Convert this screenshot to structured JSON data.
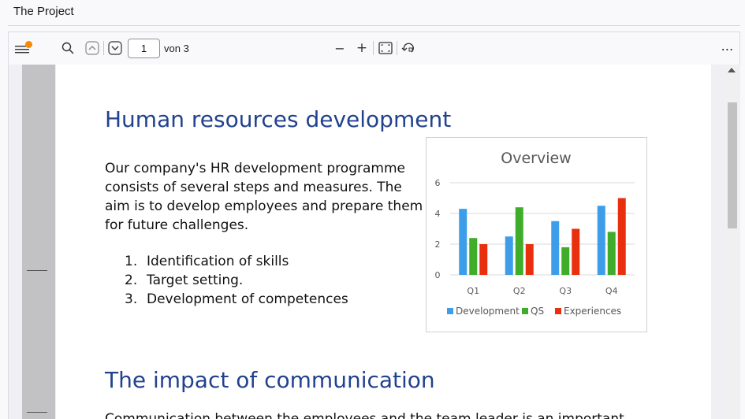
{
  "window": {
    "title": "The Project"
  },
  "toolbar": {
    "page_number": "1",
    "page_count_label": "von 3",
    "zoom_out_label": "−",
    "zoom_in_label": "+",
    "more_label": "⋯",
    "accent_color": "#f28a0c"
  },
  "document": {
    "heading1": "Human resources development",
    "intro": "Our company's HR development programme consists of several steps and measures. The aim is to develop employees and prepare them for future challenges.",
    "steps": [
      {
        "num": "1.",
        "text": "Identification of skills"
      },
      {
        "num": "2.",
        "text": "Target setting."
      },
      {
        "num": "3.",
        "text": "Development of competences"
      }
    ],
    "heading2": "The impact of communication",
    "cut_text": "Communication between the employees and the team leader is an important"
  },
  "chart_data": {
    "type": "bar",
    "title": "Overview",
    "categories": [
      "Q1",
      "Q2",
      "Q3",
      "Q4"
    ],
    "series": [
      {
        "name": "Development",
        "color": "#3d9de8",
        "values": [
          4.3,
          2.5,
          3.5,
          4.5
        ]
      },
      {
        "name": "QS",
        "color": "#3fad2a",
        "values": [
          2.4,
          4.4,
          1.8,
          2.8
        ]
      },
      {
        "name": "Experiences",
        "color": "#e8300e",
        "values": [
          2.0,
          2.0,
          3.0,
          5.0
        ]
      }
    ],
    "yticks": [
      "0",
      "2",
      "4",
      "6"
    ],
    "ylim": [
      0,
      6
    ],
    "grid": true,
    "legend_position": "bottom"
  }
}
